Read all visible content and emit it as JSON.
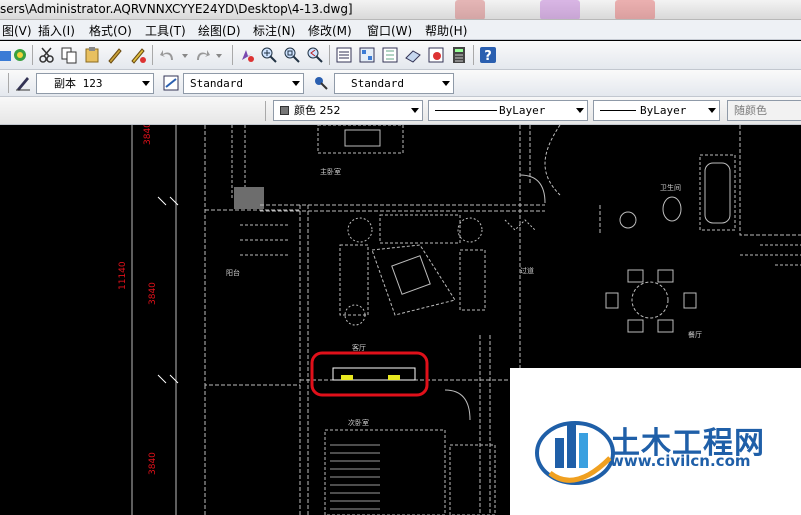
{
  "window": {
    "title": "sers\\Administrator.AQRVNNXCYYE24YD\\Desktop\\4-13.dwg]"
  },
  "menu": {
    "items": [
      "图(V)",
      "插入(I)",
      "格式(O)",
      "工具(T)",
      "绘图(D)",
      "标注(N)",
      "修改(M)",
      "窗口(W)",
      "帮助(H)"
    ]
  },
  "styles_toolbar": {
    "text_style": "副本 123",
    "dim_style": "Standard",
    "table_style": "Standard"
  },
  "properties_toolbar": {
    "color": "颜色 252",
    "linetype": "ByLayer",
    "lineweight": "ByLayer",
    "plot_style": "随颜色"
  },
  "drawing": {
    "dim_top": "3840",
    "dim_mid_total": "11140",
    "dim_mid": "3840",
    "dim_bottom": "3840",
    "room_master_bed": "主卧室",
    "room_bath": "卫生间",
    "room_dining": "餐厅",
    "room_living": "客厅",
    "room_balcony": "阳台",
    "room_hall": "过道",
    "room_bed2": "次卧室",
    "highlight_color": "#e0101a",
    "text_color": "#e8e820"
  },
  "watermark": {
    "title": "土木工程网",
    "url": "www.civilcn.com",
    "brand_color": "#1f5fa8"
  }
}
